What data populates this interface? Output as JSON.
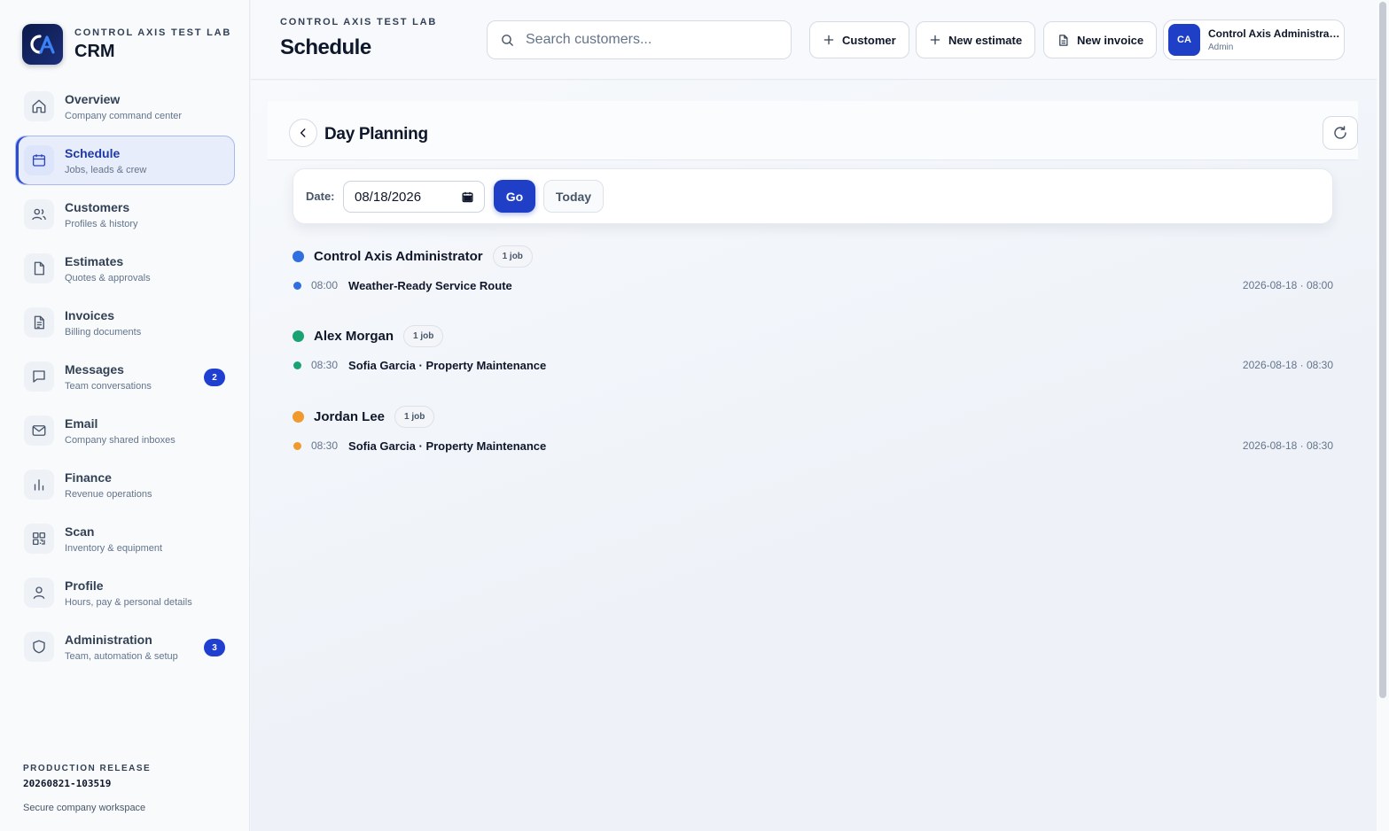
{
  "brand": {
    "subtitle": "CONTROL AXIS TEST LAB",
    "title": "CRM",
    "accent": "#1e3fc6"
  },
  "sidebar": {
    "items": [
      {
        "label": "Overview",
        "desc": "Company command center",
        "icon": "home-icon"
      },
      {
        "label": "Schedule",
        "desc": "Jobs, leads & crew",
        "icon": "calendar-icon",
        "active": true
      },
      {
        "label": "Customers",
        "desc": "Profiles & history",
        "icon": "users-icon"
      },
      {
        "label": "Estimates",
        "desc": "Quotes & approvals",
        "icon": "file-icon"
      },
      {
        "label": "Invoices",
        "desc": "Billing documents",
        "icon": "document-icon"
      },
      {
        "label": "Messages",
        "desc": "Team conversations",
        "icon": "message-icon",
        "badge": "2"
      },
      {
        "label": "Email",
        "desc": "Company shared inboxes",
        "icon": "mail-icon"
      },
      {
        "label": "Finance",
        "desc": "Revenue operations",
        "icon": "bar-chart-icon"
      },
      {
        "label": "Scan",
        "desc": "Inventory & equipment",
        "icon": "qr-code-icon"
      },
      {
        "label": "Profile",
        "desc": "Hours, pay & personal details",
        "icon": "user-icon"
      },
      {
        "label": "Administration",
        "desc": "Team, automation & setup",
        "icon": "shield-icon",
        "badge": "3"
      }
    ],
    "release": {
      "label": "PRODUCTION RELEASE",
      "build": "20260821-103519",
      "note": "Secure company workspace"
    }
  },
  "header": {
    "subtitle": "CONTROL AXIS TEST LAB",
    "title": "Schedule",
    "search_placeholder": "Search customers...",
    "buttons": {
      "customer": "Customer",
      "new_estimate": "New estimate",
      "new_invoice": "New invoice"
    },
    "user": {
      "initials": "CA",
      "name": "Control Axis Administrator",
      "role": "Admin"
    }
  },
  "panel": {
    "title": "Day Planning",
    "date_label": "Date:",
    "date_value": "08/18/2026",
    "go_label": "Go",
    "today_label": "Today"
  },
  "crews": [
    {
      "name": "Control Axis Administrator",
      "count": "1 job",
      "color": "#2f6fe0",
      "jobs": [
        {
          "time": "08:00",
          "title": "Weather-Ready Service Route",
          "stamp": "2026-08-18 · 08:00"
        }
      ]
    },
    {
      "name": "Alex Morgan",
      "count": "1 job",
      "color": "#1aa372",
      "jobs": [
        {
          "time": "08:30",
          "title": "Sofia Garcia · Property Maintenance",
          "stamp": "2026-08-18 · 08:30"
        }
      ]
    },
    {
      "name": "Jordan Lee",
      "count": "1 job",
      "color": "#ef9a2b",
      "jobs": [
        {
          "time": "08:30",
          "title": "Sofia Garcia · Property Maintenance",
          "stamp": "2026-08-18 · 08:30"
        }
      ]
    }
  ]
}
